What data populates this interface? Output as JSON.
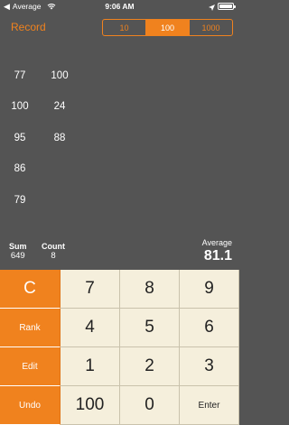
{
  "status_bar": {
    "back_app": "Average",
    "time": "9:06 AM"
  },
  "nav": {
    "record_label": "Record",
    "segments": [
      {
        "label": "10",
        "selected": false
      },
      {
        "label": "100",
        "selected": true
      },
      {
        "label": "1000",
        "selected": false
      }
    ]
  },
  "values": [
    "77",
    "100",
    "100",
    "24",
    "95",
    "88",
    "86",
    "79"
  ],
  "summary": {
    "sum_label": "Sum",
    "sum_value": "649",
    "count_label": "Count",
    "count_value": "8",
    "average_label": "Average",
    "average_value": "81.1"
  },
  "keypad": {
    "clear": "C",
    "rank": "Rank",
    "edit": "Edit",
    "undo": "Undo",
    "k7": "7",
    "k8": "8",
    "k9": "9",
    "k4": "4",
    "k5": "5",
    "k6": "6",
    "k1": "1",
    "k2": "2",
    "k3": "3",
    "k100": "100",
    "k0": "0",
    "enter": "Enter"
  },
  "colors": {
    "accent": "#f0821e",
    "background": "#545454",
    "key_face": "#f5efdc"
  }
}
